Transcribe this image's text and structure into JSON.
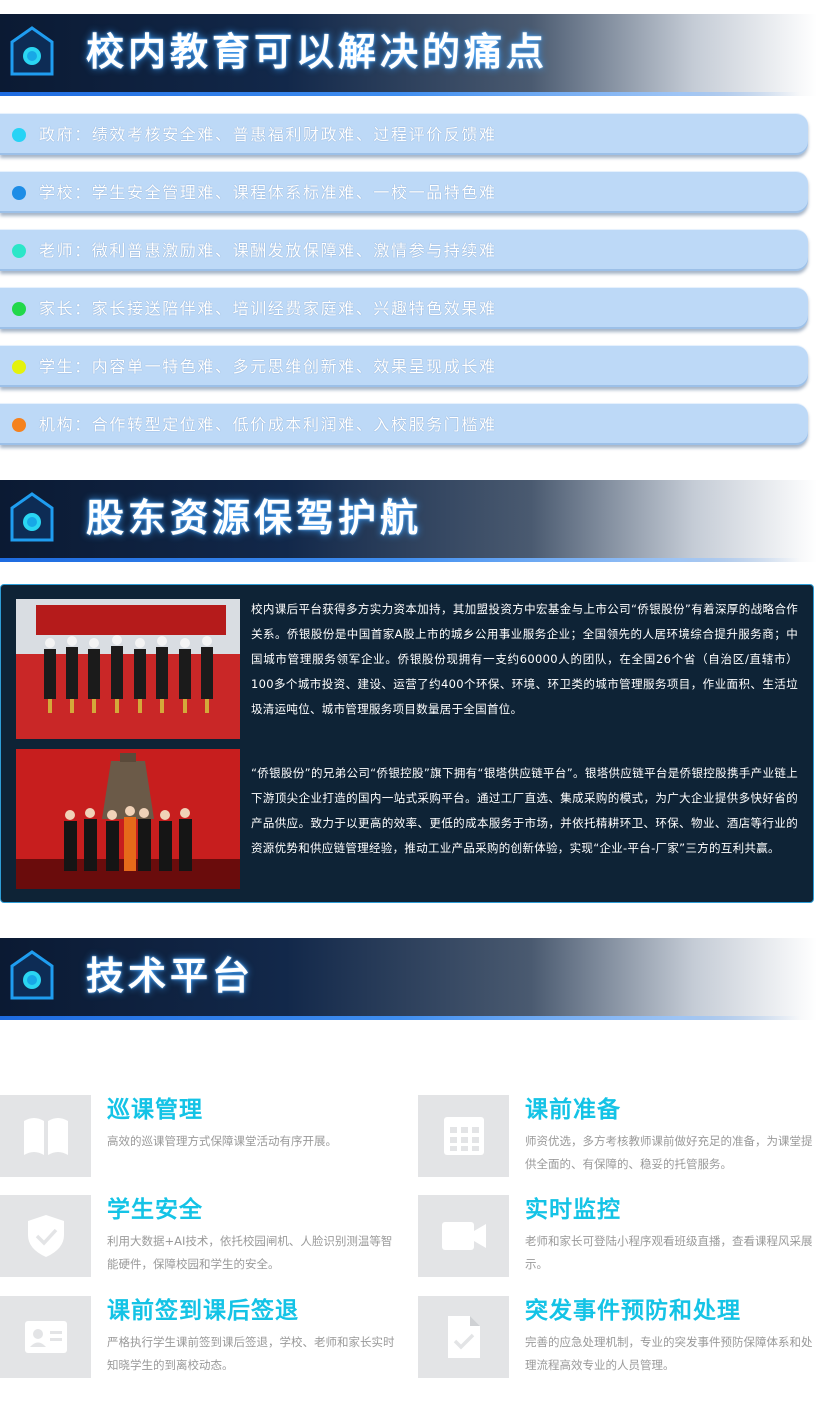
{
  "sections": {
    "pain_points": {
      "title": "校内教育可以解决的痛点",
      "items": [
        {
          "text": "政府：绩效考核安全难、普惠福利财政难、过程评价反馈难",
          "dot_color": "#27d3f5"
        },
        {
          "text": "学校：学生安全管理难、课程体系标准难、一校一品特色难",
          "dot_color": "#1e8de6"
        },
        {
          "text": "老师：微利普惠激励难、课酬发放保障难、激情参与持续难",
          "dot_color": "#2be6c8"
        },
        {
          "text": "家长：家长接送陪伴难、培训经费家庭难、兴趣特色效果难",
          "dot_color": "#22d84a"
        },
        {
          "text": "学生：内容单一特色难、多元思维创新难、效果呈现成长难",
          "dot_color": "#e4f20c"
        },
        {
          "text": "机构：合作转型定位难、低价成本利润难、入校服务门槛难",
          "dot_color": "#f5821e"
        }
      ]
    },
    "shareholders": {
      "title": "股东资源保驾护航",
      "paragraph1": "校内课后平台获得多方实力资本加持，其加盟投资方中宏基金与上市公司“侨银股份”有着深厚的战略合作关系。侨银股份是中国首家A股上市的城乡公用事业服务企业；全国领先的人居环境综合提升服务商；中国城市管理服务领军企业。侨银股份现拥有一支约60000人的团队，在全国26个省（自治区/直辖市）100多个城市投资、建设、运营了约400个环保、环境、环卫类的城市管理服务项目，作业面积、生活垃圾清运吨位、城市管理服务项目数量居于全国首位。",
      "paragraph2": "“侨银股份”的兄弟公司“侨银控股”旗下拥有“银塔供应链平台”。银塔供应链平台是侨银控股携手产业链上下游顶尖企业打造的国内一站式采购平台。通过工厂直选、集成采购的模式，为广大企业提供多快好省的产品供应。致力于以更高的效率、更低的成本服务于市场，并依托精耕环卫、环保、物业、酒店等行业的资源优势和供应链管理经验，推动工业产品采购的创新体验，实现“企业-平台-厂家”三方的互利共赢。"
    },
    "tech": {
      "title": "技术平台",
      "features": [
        {
          "icon": "book-icon",
          "title": "巡课管理",
          "desc": "高效的巡课管理方式保障课堂活动有序开展。"
        },
        {
          "icon": "calendar-icon",
          "title": "课前准备",
          "desc": "师资优选，多方考核教师课前做好充足的准备，为课堂提供全面的、有保障的、稳妥的托管服务。"
        },
        {
          "icon": "shield-check-icon",
          "title": "学生安全",
          "desc": "利用大数据+AI技术，依托校园闸机、人脸识别测温等智能硬件，保障校园和学生的安全。"
        },
        {
          "icon": "video-camera-icon",
          "title": "实时监控",
          "desc": "老师和家长可登陆小程序观看班级直播，查看课程风采展示。"
        },
        {
          "icon": "id-card-icon",
          "title": "课前签到课后签退",
          "desc": "严格执行学生课前签到课后签退，学校、老师和家长实时知晓学生的到离校动态。"
        },
        {
          "icon": "document-check-icon",
          "title": "突发事件预防和处理",
          "desc": "完善的应急处理机制，专业的突发事件预防保障体系和处理流程高效专业的人员管理。"
        }
      ]
    }
  }
}
